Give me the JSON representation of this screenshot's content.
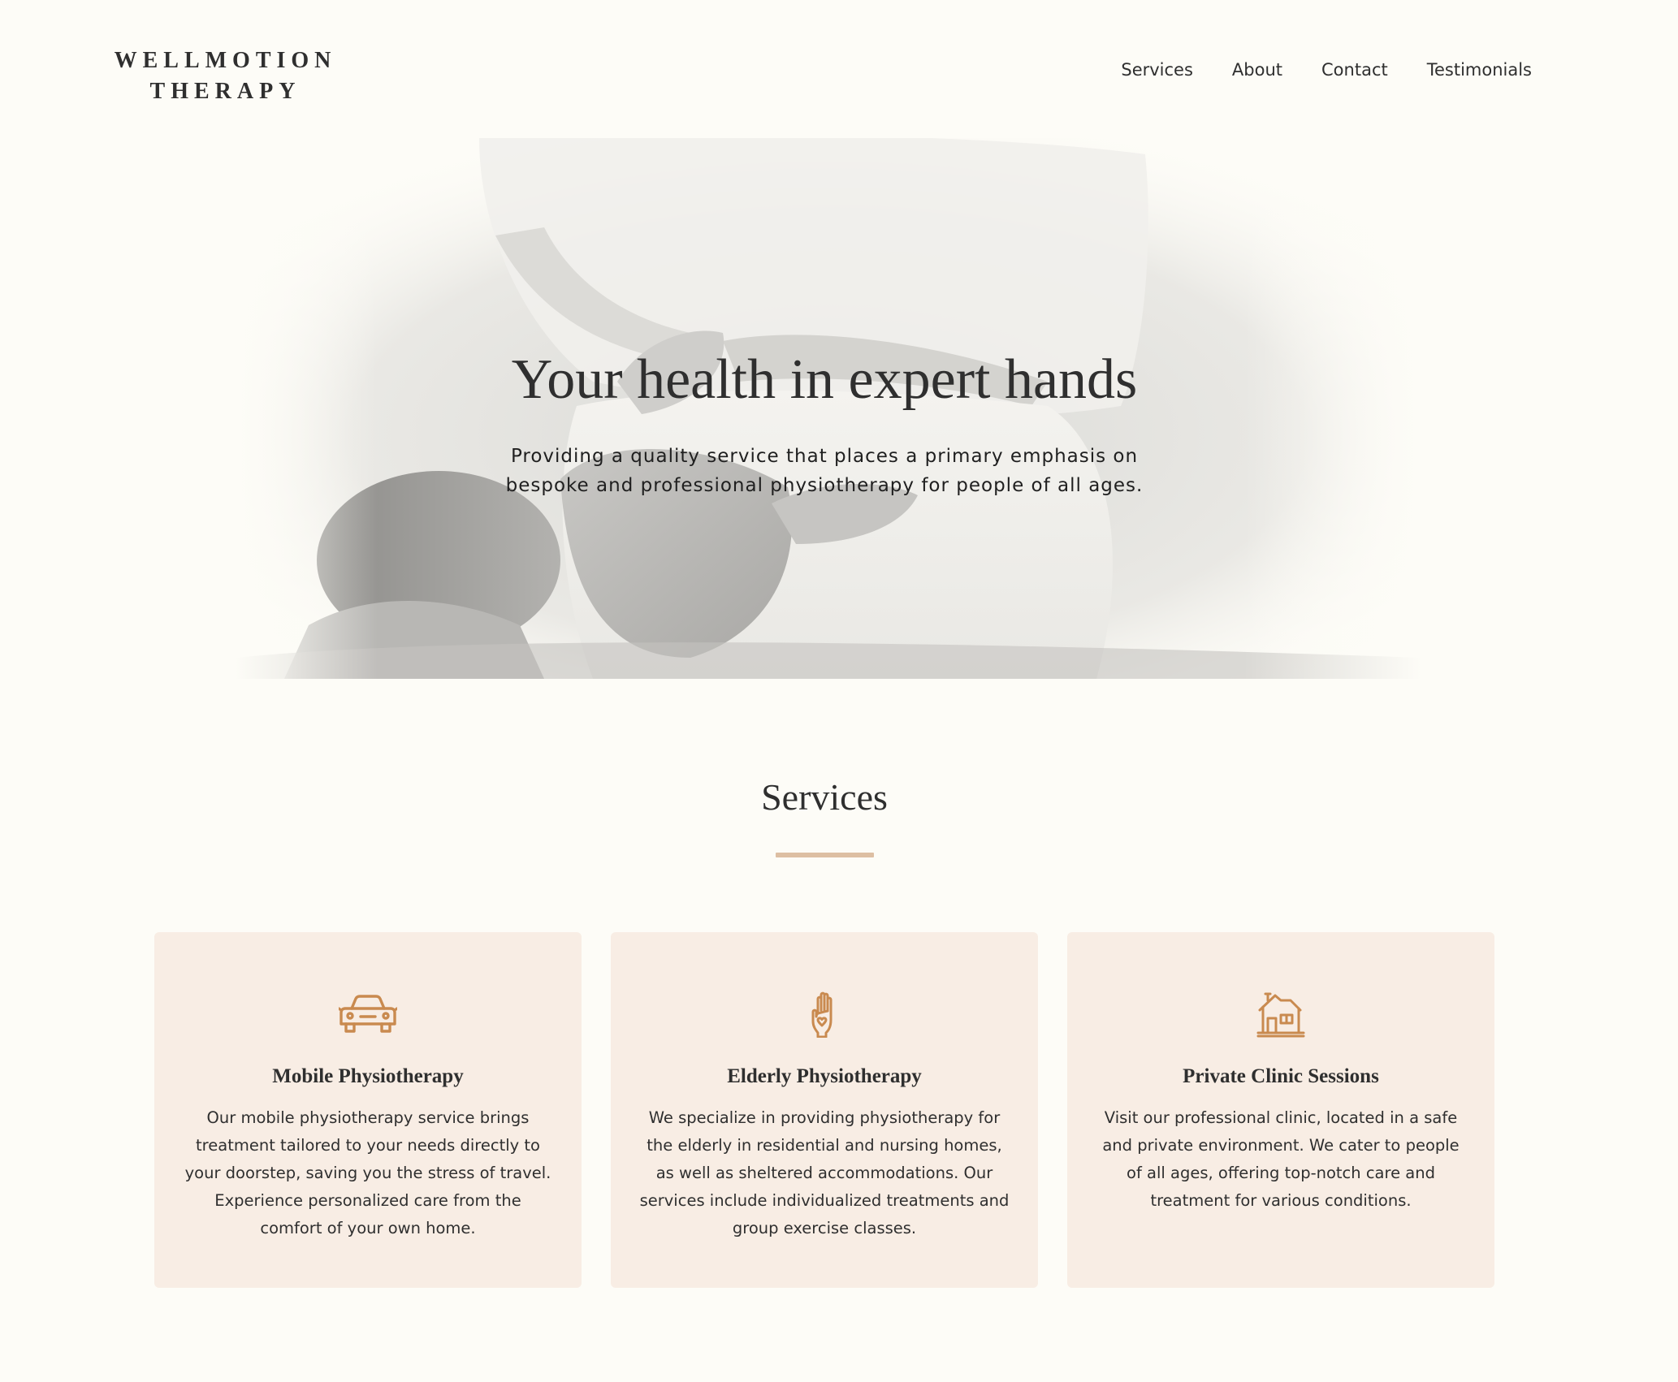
{
  "brand": {
    "line1": "WELLMOTION",
    "line2": "THERAPY"
  },
  "nav": {
    "items": [
      "Services",
      "About",
      "Contact",
      "Testimonials"
    ]
  },
  "hero": {
    "title": "Your health in expert hands",
    "subtitle": "Providing a quality service that places a primary emphasis on bespoke and professional physiotherapy for people of all ages.",
    "image": "physiotherapist-massaging-patient-shoulder-photo"
  },
  "services": {
    "title": "Services",
    "cards": [
      {
        "icon": "car-icon",
        "title": "Mobile Physiotherapy",
        "text": "Our mobile physiotherapy service brings treatment tailored to your needs directly to your doorstep, saving you the stress of travel. Experience personalized care from the comfort of your own home."
      },
      {
        "icon": "hand-heart-icon",
        "title": "Elderly Physiotherapy",
        "text": "We specialize in providing physiotherapy for the elderly in residential and nursing homes, as well as sheltered accommodations. Our services include individualized treatments and group exercise classes."
      },
      {
        "icon": "house-icon",
        "title": "Private Clinic Sessions",
        "text": "Visit our professional clinic, located in a safe and private environment. We cater to people of all ages, offering top-notch care and treatment for various conditions."
      }
    ]
  },
  "colors": {
    "background": "#fdfcf7",
    "card_background": "#f8ede4",
    "accent": "#c98a4f",
    "divider": "#ddbfa3",
    "text": "#2f2f2f"
  }
}
